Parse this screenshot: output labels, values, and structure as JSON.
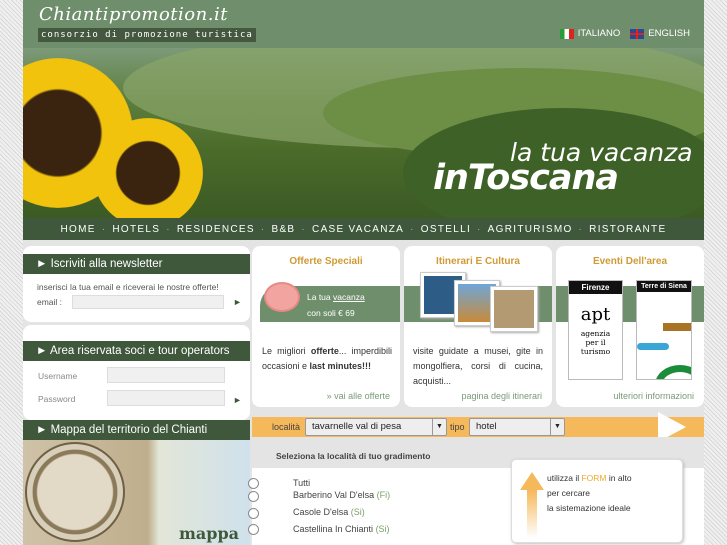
{
  "header": {
    "logo": "Chiantipromotion.it",
    "tagline": "consorzio di promozione turistica",
    "languages": [
      {
        "label": "ITALIANO"
      },
      {
        "label": "ENGLISH"
      }
    ]
  },
  "hero": {
    "slogan_line1": "la tua vacanza",
    "slogan_line2": "inToscana"
  },
  "nav": [
    "HOME",
    "HOTELS",
    "RESIDENCES",
    "B&B",
    "CASE VACANZA",
    "OSTELLI",
    "AGRITURISMO",
    "RISTORANTE"
  ],
  "newsletter": {
    "title": "► Iscriviti alla newsletter",
    "text": "inserisci la tua email e riceverai le nostre offerte!",
    "email_label": "email :",
    "email_value": "",
    "submit": "►"
  },
  "reserved": {
    "title": "► Area riservata soci e tour operators",
    "username_label": "Username",
    "password_label": "Password",
    "submit": "►"
  },
  "map": {
    "title": "► Mappa del territorio del Chianti",
    "caption": "mappa"
  },
  "offers": {
    "title": "Offerte Speciali",
    "band_line1": "La tua",
    "band_link": "vacanza",
    "band_line2": "con soli € 69",
    "text_pre": "Le migliori ",
    "text_bold1": "offerte",
    "text_mid": "... imperdibili occasioni e ",
    "text_bold2": "last minutes!!!",
    "link": "» vai alle offerte"
  },
  "itineraries": {
    "title": "Itinerari E Cultura",
    "text": "visite guidate a musei, gite in mongolfiera, corsi di cucina, acquisti...",
    "link": "pagina degli itinerari"
  },
  "events": {
    "title": "Eventi Dell'area",
    "logo1_title": "Firenze",
    "logo1_text": "agenzia per il turismo",
    "logo1_mark": "apt",
    "logo2_title": "Terre di Siena",
    "link": "ulteriori informazioni"
  },
  "search": {
    "location_label": "località",
    "location_value": "tavarnelle val di pesa",
    "type_label": "tipo",
    "type_value": "hotel"
  },
  "listing": {
    "heading": "Seleziona la località di tuo gradimento",
    "items": [
      {
        "name": "Tutti",
        "prov": ""
      },
      {
        "name": "Barberino Val D'elsa",
        "prov": "(Fi)"
      },
      {
        "name": "Casole D'elsa",
        "prov": "(Si)"
      },
      {
        "name": "Castellina In Chianti",
        "prov": "(Si)"
      }
    ]
  },
  "hint": {
    "pre": "utilizza il ",
    "form": "FORM",
    "post": " in alto",
    "line2": "per cercare",
    "line3": "la sistemazione ideale"
  },
  "colors": {
    "green": "#6f8f6c",
    "dark_green": "#3f583c",
    "orange": "#f5b85a",
    "gold": "#d09a35"
  }
}
